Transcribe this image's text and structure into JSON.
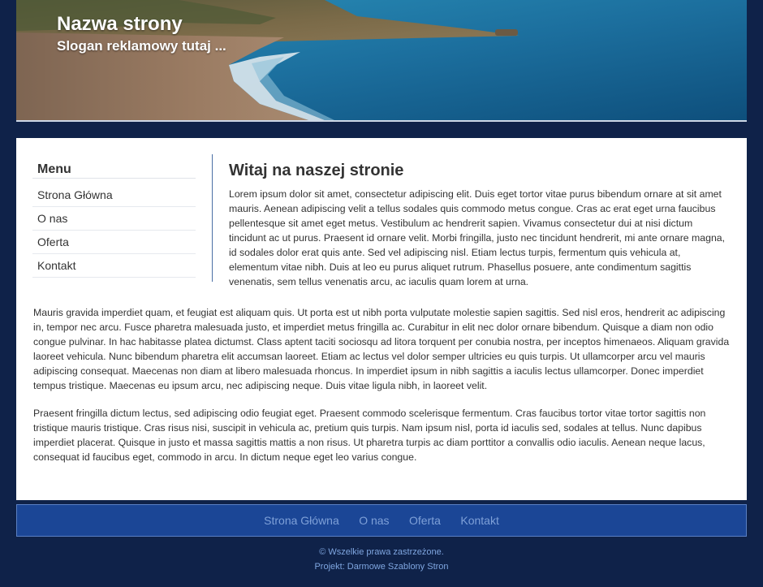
{
  "header": {
    "site_title": "Nazwa strony",
    "slogan": "Slogan reklamowy tutaj ..."
  },
  "sidebar": {
    "heading": "Menu",
    "items": [
      {
        "label": "Strona Główna"
      },
      {
        "label": "O nas"
      },
      {
        "label": "Oferta"
      },
      {
        "label": "Kontakt"
      }
    ]
  },
  "main": {
    "heading": "Witaj na naszej stronie",
    "intro": "Lorem ipsum dolor sit amet, consectetur adipiscing elit. Duis eget tortor vitae purus bibendum ornare at sit amet mauris. Aenean adipiscing velit a tellus sodales quis commodo metus congue. Cras ac erat eget urna faucibus pellentesque sit amet eget metus. Vestibulum ac hendrerit sapien. Vivamus consectetur dui at nisi dictum tincidunt ac ut purus. Praesent id ornare velit. Morbi fringilla, justo nec tincidunt hendrerit, mi ante ornare magna, id sodales dolor erat quis ante. Sed vel adipiscing nisl. Etiam lectus turpis, fermentum quis vehicula at, elementum vitae nibh. Duis at leo eu purus aliquet rutrum. Phasellus posuere, ante condimentum sagittis venenatis, sem tellus venenatis arcu, ac iaculis quam lorem at urna.",
    "paragraph_2": "Mauris gravida imperdiet quam, et feugiat est aliquam quis. Ut porta est ut nibh porta vulputate molestie sapien sagittis. Sed nisl eros, hendrerit ac adipiscing in, tempor nec arcu. Fusce pharetra malesuada justo, et imperdiet metus fringilla ac. Curabitur in elit nec dolor ornare bibendum. Quisque a diam non odio congue pulvinar. In hac habitasse platea dictumst. Class aptent taciti sociosqu ad litora torquent per conubia nostra, per inceptos himenaeos. Aliquam gravida laoreet vehicula. Nunc bibendum pharetra elit accumsan laoreet. Etiam ac lectus vel dolor semper ultricies eu quis turpis. Ut ullamcorper arcu vel mauris adipiscing consequat. Maecenas non diam at libero malesuada rhoncus. In imperdiet ipsum in nibh sagittis a iaculis lectus ullamcorper. Donec imperdiet tempus tristique. Maecenas eu ipsum arcu, nec adipiscing neque. Duis vitae ligula nibh, in laoreet velit.",
    "paragraph_3": "Praesent fringilla dictum lectus, sed adipiscing odio feugiat eget. Praesent commodo scelerisque fermentum. Cras faucibus tortor vitae tortor sagittis non tristique mauris tristique. Cras risus nisi, suscipit in vehicula ac, pretium quis turpis. Nam ipsum nisl, porta id iaculis sed, sodales at tellus. Nunc dapibus imperdiet placerat. Quisque in justo et massa sagittis mattis a non risus. Ut pharetra turpis ac diam porttitor a convallis odio iaculis. Aenean neque lacus, consequat id faucibus eget, commodo in arcu. In dictum neque eget leo varius congue."
  },
  "footer": {
    "nav": [
      {
        "label": "Strona Główna"
      },
      {
        "label": "O nas"
      },
      {
        "label": "Oferta"
      },
      {
        "label": "Kontakt"
      }
    ],
    "copyright": "© Wszelkie prawa zastrzeżone.",
    "credit": "Projekt: Darmowe Szablony Stron"
  },
  "colors": {
    "page_background": "#0f2249",
    "footer_nav_background": "#1b4696",
    "footer_link": "#7ea0d8",
    "content_background": "#ffffff"
  }
}
